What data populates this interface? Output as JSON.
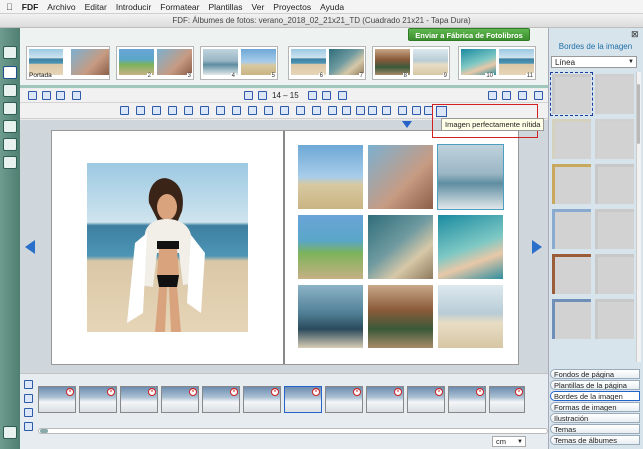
{
  "menubar": {
    "apple": "",
    "items": [
      "FDF",
      "Archivo",
      "Editar",
      "Introducir",
      "Formatear",
      "Plantillas",
      "Ver",
      "Proyectos",
      "Ayuda"
    ]
  },
  "window": {
    "title": "FDF: Álbumes de fotos: verano_2018_02_21x21_TD (Cuadrado 21x21 - Tapa Dura)"
  },
  "pagestrip": {
    "order_button": "Enviar a Fábrica de Fotolibros",
    "pages": [
      {
        "label": "Portada",
        "num": ""
      },
      {
        "label": "",
        "num": "1"
      },
      {
        "label": "",
        "num": "2"
      },
      {
        "label": "",
        "num": "3"
      },
      {
        "label": "",
        "num": "4"
      },
      {
        "label": "",
        "num": "5"
      },
      {
        "label": "",
        "num": "6"
      },
      {
        "label": "",
        "num": "7"
      },
      {
        "label": "",
        "num": "8"
      },
      {
        "label": "",
        "num": "9"
      },
      {
        "label": "",
        "num": "10"
      },
      {
        "label": "",
        "num": "11"
      }
    ]
  },
  "navigation": {
    "pages_label": "14 – 15"
  },
  "tooltip": {
    "text": "Imagen perfectamente nítida"
  },
  "unit": {
    "value": "cm"
  },
  "rightpanel": {
    "title": "Bordes de la imagen",
    "select_value": "Línea",
    "categories": [
      "Fondos de página",
      "Plantillas de la página",
      "Bordes de la imagen",
      "Formas de imagen",
      "Ilustración",
      "Temas",
      "Temas de álbumes"
    ],
    "active_category": "Bordes de la imagen",
    "swatch_colors": [
      "#c9c9c9",
      "#cfcfcf",
      "#d4d2bf",
      "#d0d0d0",
      "#c7a85c",
      "#c8c8c8",
      "#8aaad0",
      "#c9c9c9",
      "#9b5c3a",
      "#c8c8c8",
      "#6f8fb8",
      "#c9c9c9",
      "#6a4a38",
      "#cfcfcf",
      "#d8d8d8",
      "#cfcfcf"
    ]
  }
}
